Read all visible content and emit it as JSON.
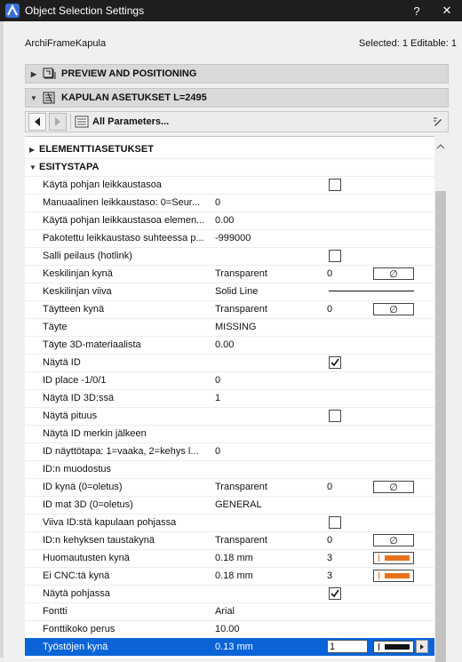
{
  "window": {
    "title": "Object Selection Settings",
    "help": "?",
    "close": "✕"
  },
  "header": {
    "library_part": "ArchiFrameKapula",
    "selection_info": "Selected: 1 Editable: 1"
  },
  "sections": {
    "preview": "PREVIEW AND POSITIONING",
    "settings": "KAPULAN ASETUKSET L=2495"
  },
  "nav": {
    "selector_label": "All Parameters..."
  },
  "groups": {
    "elementti": "ELEMENTTIASETUKSET",
    "esitystapa": "ESITYSTAPA"
  },
  "params": [
    {
      "name": "Käytä pohjan leikkaustasoa",
      "type": "check",
      "checked": false
    },
    {
      "name": "Manuaalinen leikkaustaso: 0=Seur...",
      "value": "0"
    },
    {
      "name": "Käytä pohjan leikkaustasoa elemen...",
      "value": "0.00"
    },
    {
      "name": "Pakotettu leikkaustaso suhteessa p...",
      "value": "-999000"
    },
    {
      "name": "Salli peilaus (hotlink)",
      "type": "check",
      "checked": false
    },
    {
      "name": "Keskilinjan kynä",
      "value": "Transparent",
      "num": "0",
      "pen": "empty"
    },
    {
      "name": "Keskilinjan viiva",
      "value": "Solid Line",
      "line": true
    },
    {
      "name": "Täytteen kynä",
      "value": "Transparent",
      "num": "0",
      "pen": "empty"
    },
    {
      "name": "Täyte",
      "value": "MISSING"
    },
    {
      "name": "Täyte 3D-materiaalista",
      "value": "0.00"
    },
    {
      "name": "Näytä ID",
      "type": "check",
      "checked": true
    },
    {
      "name": "ID place -1/0/1",
      "value": "0"
    },
    {
      "name": "Näytä ID 3D:ssä",
      "value": "1"
    },
    {
      "name": "Näytä pituus",
      "type": "check",
      "checked": false
    },
    {
      "name": "Näytä ID merkin jälkeen",
      "value": ""
    },
    {
      "name": "ID näyttötapa: 1=vaaka, 2=kehys l...",
      "value": "0"
    },
    {
      "name": "ID:n muodostus",
      "value": ""
    },
    {
      "name": "ID kynä (0=oletus)",
      "value": "Transparent",
      "num": "0",
      "pen": "empty"
    },
    {
      "name": "ID mat 3D (0=oletus)",
      "value": "GENERAL"
    },
    {
      "name": "Viiva ID:stä kapulaan pohjassa",
      "type": "check",
      "checked": false
    },
    {
      "name": "ID:n kehyksen taustakynä",
      "value": "Transparent",
      "num": "0",
      "pen": "empty"
    },
    {
      "name": "Huomautusten kynä",
      "value": "0.18 mm",
      "num": "3",
      "pen": "orange"
    },
    {
      "name": "Ei CNC:tä kynä",
      "value": "0.18 mm",
      "num": "3",
      "pen": "orange"
    },
    {
      "name": "Näytä pohjassa",
      "type": "check",
      "checked": true
    },
    {
      "name": "Fontti",
      "value": "Arial",
      "flat": true
    },
    {
      "name": "Fonttikoko perus",
      "value": "10.00",
      "flat": true
    },
    {
      "name": "Työstöjen kynä",
      "value": "0.13 mm",
      "num": "1",
      "pen": "dark",
      "selected": true,
      "flat": true
    }
  ],
  "pen_empty_symbol": "∅",
  "colors": {
    "titlebar": "#1e1e1e",
    "selection": "#0a64d8",
    "pen_orange": "#e8731a"
  }
}
